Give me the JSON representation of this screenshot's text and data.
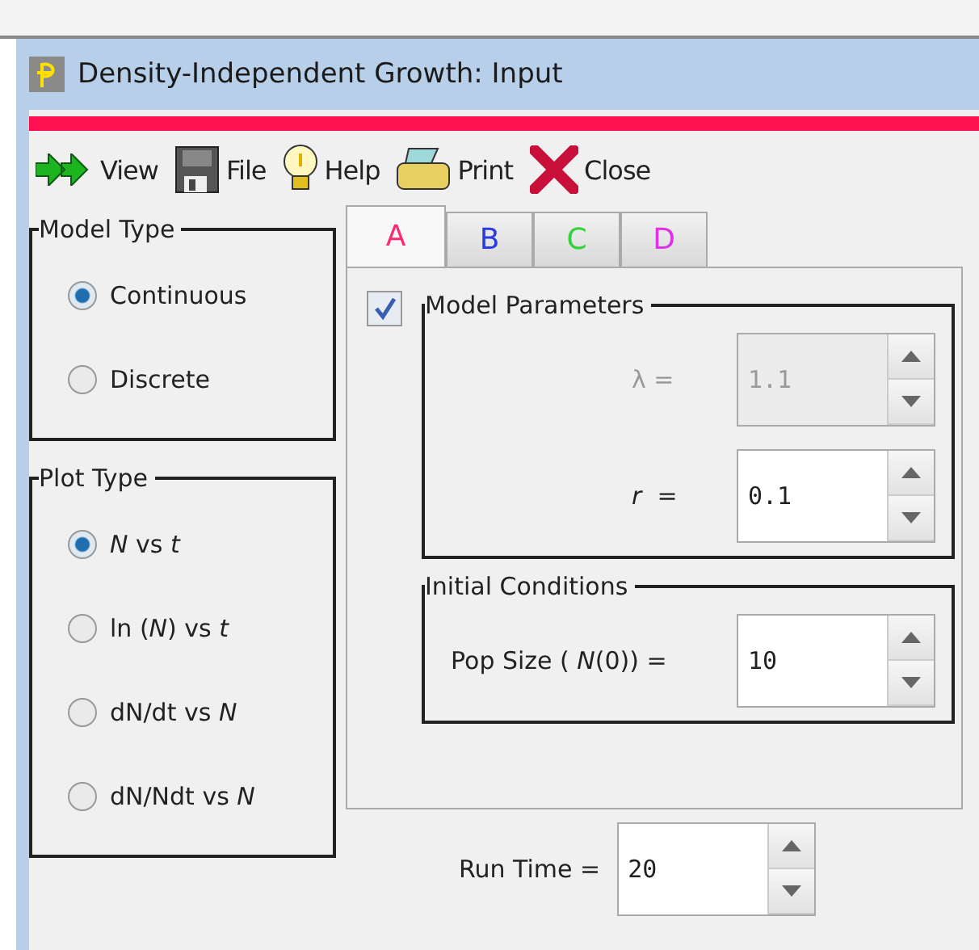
{
  "window": {
    "title": "Density-Independent Growth: Input"
  },
  "toolbar": [
    {
      "kind": "view",
      "label": "View"
    },
    {
      "kind": "file",
      "label": "File"
    },
    {
      "kind": "help",
      "label": "Help"
    },
    {
      "kind": "print",
      "label": "Print"
    },
    {
      "kind": "close",
      "label": "Close"
    }
  ],
  "model_type": {
    "title": "Model Type",
    "options": [
      {
        "label": "Continuous",
        "selected": true
      },
      {
        "label": "Discrete",
        "selected": false
      }
    ]
  },
  "plot_type": {
    "title": "Plot Type",
    "options": [
      {
        "label": "*N* vs *t*",
        "selected": true
      },
      {
        "label": "ln (*N*) vs *t*",
        "selected": false
      },
      {
        "label": "dN/dt vs *N*",
        "selected": false
      },
      {
        "label": "dN/Ndt vs *N*",
        "selected": false
      }
    ]
  },
  "tabs": [
    {
      "label": "A",
      "color": "#ff2a6d",
      "selected": true
    },
    {
      "label": "B",
      "color": "#2a3de0",
      "selected": false
    },
    {
      "label": "C",
      "color": "#33d13a",
      "selected": false
    },
    {
      "label": "D",
      "color": "#e030e8",
      "selected": false
    }
  ],
  "checkbox": {
    "checked": true
  },
  "model_parameters": {
    "title": "Model Parameters",
    "fields": [
      {
        "label": "λ =",
        "value": "1.1",
        "disabled": true
      },
      {
        "label": "*r*  =",
        "value": "0.1",
        "disabled": false
      }
    ]
  },
  "initial_conditions": {
    "title": "Initial Conditions",
    "fields": [
      {
        "label": "Pop Size ( *N*(0)) =",
        "value": "10",
        "disabled": false
      }
    ]
  },
  "run_time": {
    "label": "Run Time =",
    "value": "20"
  }
}
